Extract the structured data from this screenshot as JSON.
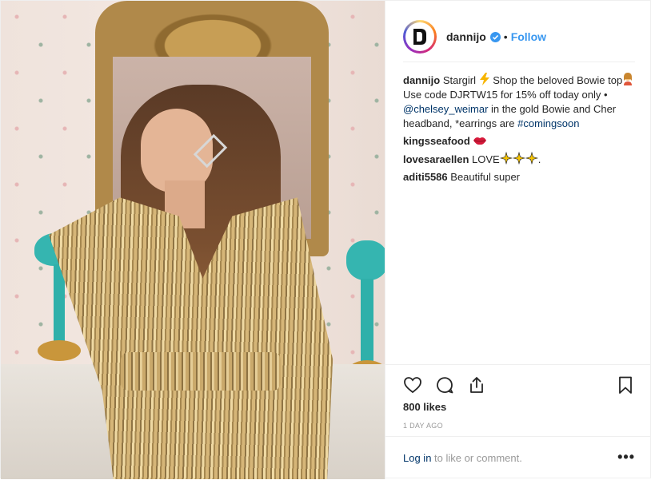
{
  "header": {
    "username": "dannijo",
    "follow_label": "Follow",
    "separator": "•"
  },
  "caption": {
    "user": "dannijo",
    "text_1": "Stargirl",
    "text_2": "Shop the beloved Bowie top",
    "text_3": "Use code DJRTW15 for 15% off today only •",
    "mention": "@chelsey_weimar",
    "text_4": "in the gold Bowie and Cher headband, *earrings are",
    "hashtag": "#comingsoon"
  },
  "comments": [
    {
      "user": "kingsseafood",
      "text": ""
    },
    {
      "user": "lovesaraellen",
      "text": "LOVE",
      "trail": "."
    },
    {
      "user": "aditi5586",
      "text": "Beautiful super"
    }
  ],
  "likes": "800 likes",
  "timestamp": "1 DAY AGO",
  "footer": {
    "login_link": "Log in",
    "login_text": " to like or comment.",
    "more": "•••"
  },
  "icons": {
    "verified": "verified-badge-icon",
    "lightning": "lightning-emoji-icon",
    "woman": "woman-emoji-icon",
    "lips": "lips-emoji-icon",
    "sparkles": "sparkles-emoji-icon",
    "like": "heart-icon",
    "comment": "comment-bubble-icon",
    "share": "share-icon",
    "save": "bookmark-icon"
  },
  "colors": {
    "link_blue": "#3897f0",
    "mention_blue": "#003569",
    "verified_blue": "#3897f0",
    "text": "#262626",
    "muted": "#999999"
  }
}
